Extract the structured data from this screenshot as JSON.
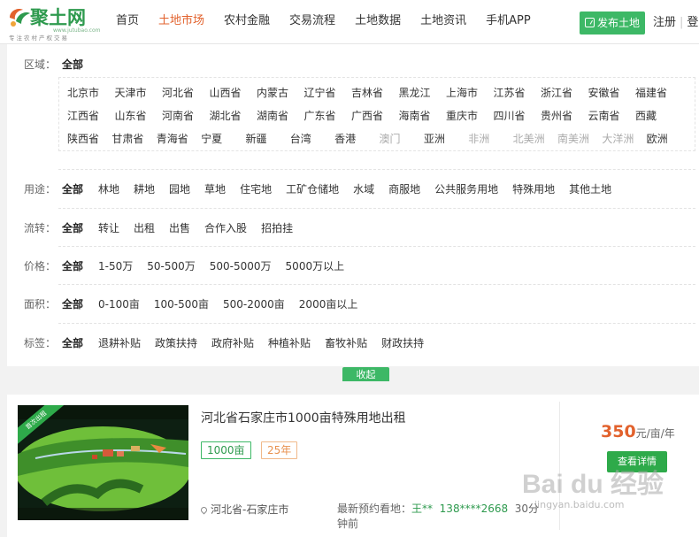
{
  "logo": {
    "name": "聚土网",
    "domain": "www.jutubao.com",
    "slogan": "专注农村产权交易"
  },
  "nav": [
    "首页",
    "土地市场",
    "农村金融",
    "交易流程",
    "土地数据",
    "土地资讯",
    "手机APP"
  ],
  "nav_active": "土地市场",
  "header": {
    "publish_label": "发布土地",
    "register": "注册",
    "separator": "|",
    "login": "登"
  },
  "filters": {
    "region": {
      "label": "区域：",
      "all": "全部",
      "rows": [
        [
          "北京市",
          "天津市",
          "河北省",
          "山西省",
          "内蒙古",
          "辽宁省",
          "吉林省",
          "黑龙江",
          "上海市",
          "江苏省",
          "浙江省",
          "安徽省",
          "福建省"
        ],
        [
          "江西省",
          "山东省",
          "河南省",
          "湖北省",
          "湖南省",
          "广东省",
          "广西省",
          "海南省",
          "重庆市",
          "四川省",
          "贵州省",
          "云南省",
          "西藏"
        ],
        [
          "陕西省",
          "甘肃省",
          "青海省",
          "宁夏",
          "新疆",
          "台湾",
          "香港",
          "澳门",
          "亚洲",
          "非洲",
          "北美洲",
          "南美洲",
          "大洋洲",
          "欧洲"
        ]
      ],
      "dim_items": [
        "澳门",
        "非洲",
        "北美洲",
        "南美洲",
        "大洋洲"
      ]
    },
    "usage": {
      "label": "用途：",
      "all": "全部",
      "options": [
        "林地",
        "耕地",
        "园地",
        "草地",
        "住宅地",
        "工矿仓储地",
        "水域",
        "商服地",
        "公共服务用地",
        "特殊用地",
        "其他土地"
      ]
    },
    "transfer": {
      "label": "流转：",
      "all": "全部",
      "options": [
        "转让",
        "出租",
        "出售",
        "合作入股",
        "招拍挂"
      ]
    },
    "price": {
      "label": "价格：",
      "all": "全部",
      "options": [
        "1-50万",
        "50-500万",
        "500-5000万",
        "5000万以上"
      ]
    },
    "area": {
      "label": "面积：",
      "all": "全部",
      "options": [
        "0-100亩",
        "100-500亩",
        "500-2000亩",
        "2000亩以上"
      ]
    },
    "tags": {
      "label": "标签：",
      "all": "全部",
      "options": [
        "退耕补贴",
        "政策扶持",
        "政府补贴",
        "种植补贴",
        "畜牧补贴",
        "财政扶持"
      ]
    }
  },
  "collapse_label": "收起",
  "listing": {
    "badge": "首次出租",
    "title": "河北省石家庄市1000亩特殊用地出租",
    "tag_area": "1000亩",
    "tag_years": "25年",
    "location": "河北省-石家庄市",
    "booking_prefix": "最新预约看地：",
    "booking_name": "王**",
    "booking_phone": "138****2668",
    "booking_time": "30分钟前",
    "price_value": "350",
    "price_unit": "元/亩/年",
    "detail_label": "查看详情"
  },
  "watermark": {
    "main": "Bai du 经验",
    "sub": "jingyan.baidu.com"
  },
  "colors": {
    "accent_green": "#3db866",
    "accent_orange": "#e2622d"
  }
}
